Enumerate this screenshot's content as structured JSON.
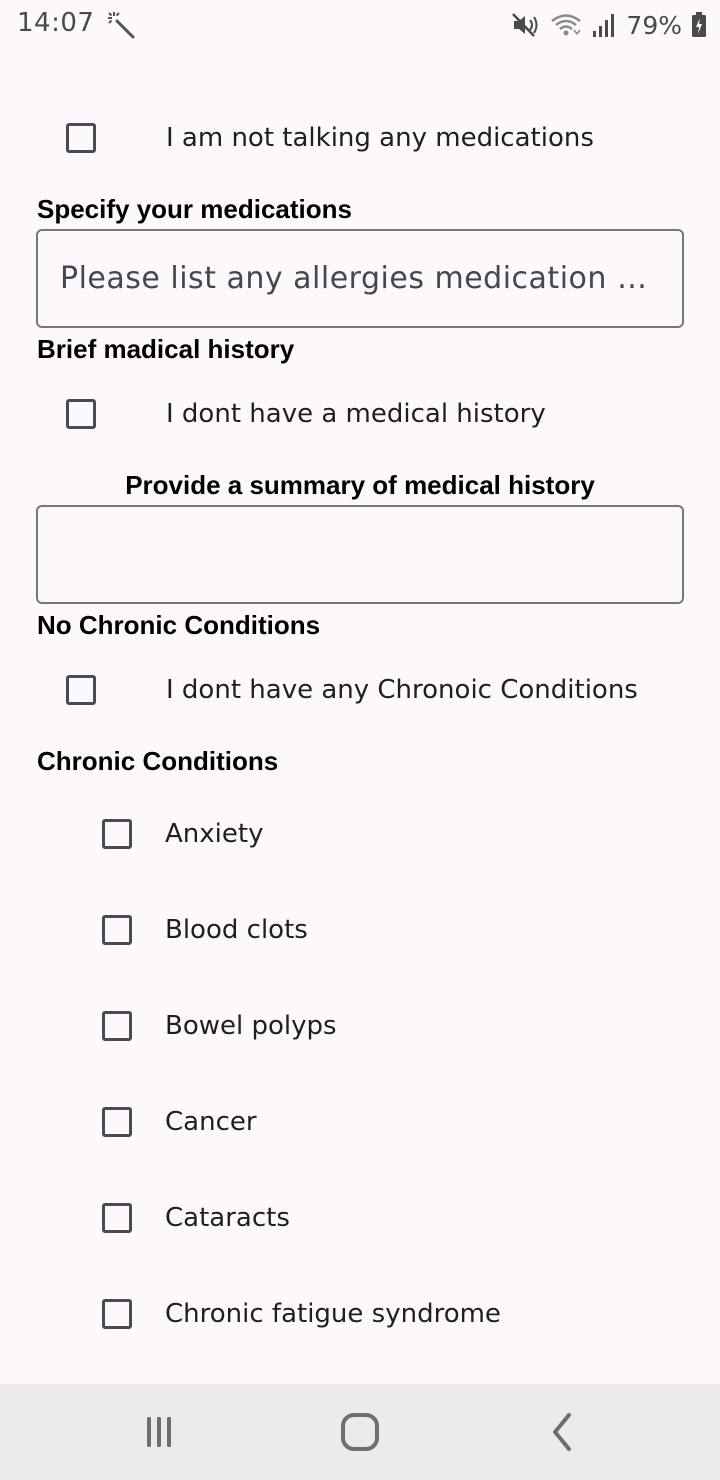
{
  "status_bar": {
    "time": "14:07",
    "left_icon": "magic-wand-icon",
    "battery_percent": "79%",
    "right_icons": [
      "mute-icon",
      "wifi-icon",
      "signal-icon",
      "battery-charging-icon"
    ]
  },
  "form": {
    "no_medications_label": "I am not talking any medications",
    "medications_title": "Specify your medications",
    "medications_placeholder": "Please list any allergies medication you are taking",
    "medical_history_title": "Brief madical history",
    "no_history_label": "I dont have a medical history",
    "history_summary_title": "Provide a summary of medical history",
    "history_value": "",
    "no_chronic_title": "No Chronic Conditions",
    "no_chronic_label": "I dont have any Chronoic Conditions",
    "chronic_title": "Chronic Conditions",
    "conditions": [
      {
        "label": "Anxiety",
        "checked": false
      },
      {
        "label": "Blood clots",
        "checked": false
      },
      {
        "label": "Bowel polyps",
        "checked": false
      },
      {
        "label": "Cancer",
        "checked": false
      },
      {
        "label": "Cataracts",
        "checked": false
      },
      {
        "label": "Chronic fatigue syndrome",
        "checked": false
      }
    ]
  },
  "nav_bar": {
    "buttons": [
      "recent-apps-icon",
      "home-icon",
      "back-icon"
    ],
    "background": "#ebebeb"
  },
  "colors": {
    "background": "#fdf8fc",
    "checkbox_border": "#4a4a52",
    "field_border": "#76767e"
  }
}
